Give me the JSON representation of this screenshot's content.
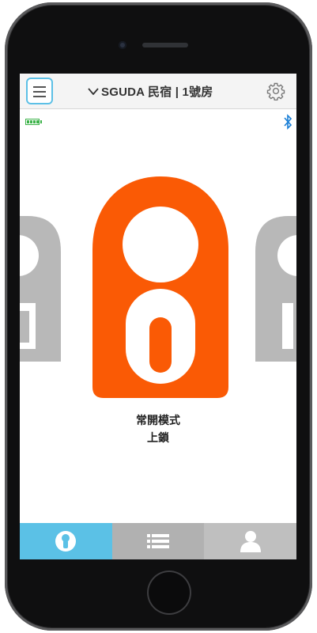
{
  "header": {
    "title": "SGUDA 民宿 | 1號房"
  },
  "lock": {
    "status_line1": "常開模式",
    "status_line2": "上鎖",
    "mode_color": "#fa5a05",
    "inactive_color": "#b8b8b8"
  },
  "tabs": [
    {
      "name": "lock-tab",
      "icon": "keyhole-icon",
      "active": true
    },
    {
      "name": "list-tab",
      "icon": "list-icon",
      "active": false
    },
    {
      "name": "profile-tab",
      "icon": "person-icon",
      "active": false
    }
  ],
  "colors": {
    "accent": "#5bc1e6",
    "bluetooth": "#1a7fd6",
    "battery": "#3db34a"
  }
}
